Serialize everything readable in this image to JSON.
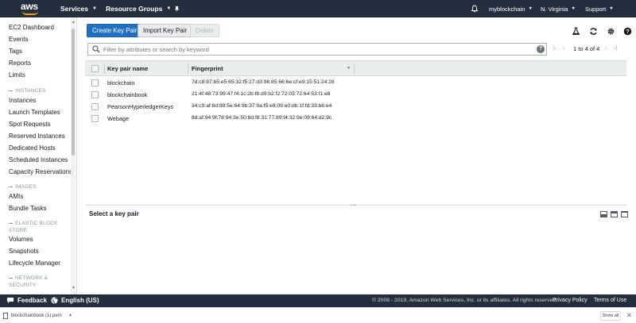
{
  "topnav": {
    "logo": "aws",
    "services": "Services",
    "resource_groups": "Resource Groups",
    "account": "myblockchain",
    "region": "N. Virginia",
    "support": "Support"
  },
  "sidebar": {
    "items_top": [
      "EC2 Dashboard",
      "Events",
      "Tags",
      "Reports",
      "Limits"
    ],
    "section_instances": "INSTANCES",
    "items_instances": [
      "Instances",
      "Launch Templates",
      "Spot Requests",
      "Reserved Instances",
      "Dedicated Hosts",
      "Scheduled Instances",
      "Capacity Reservations"
    ],
    "section_images": "IMAGES",
    "items_images": [
      "AMIs",
      "Bundle Tasks"
    ],
    "section_ebs_1": "ELASTIC BLOCK",
    "section_ebs_2": "STORE",
    "items_ebs": [
      "Volumes",
      "Snapshots",
      "Lifecycle Manager"
    ],
    "section_net_1": "NETWORK &",
    "section_net_2": "SECURITY"
  },
  "toolbar": {
    "create": "Create Key Pair",
    "import": "Import Key Pair",
    "delete": "Delete"
  },
  "search": {
    "placeholder": "Filter by attributes or search by keyword"
  },
  "pager": {
    "text": "1 to 4 of 4"
  },
  "table": {
    "columns": [
      "Key pair name",
      "Fingerprint"
    ],
    "rows": [
      {
        "name": "blockchain",
        "fingerprint": "7d:c8:87:b5:e5:65:32:f5:27:d3:96:85:66:6e:cf:e9:15:51:24:26"
      },
      {
        "name": "blockchainbook",
        "fingerprint": "21:4f:48:73:99:47:f4:1c:2b:f8:d9:b2:f2:72:03:72:64:53:f1:e8"
      },
      {
        "name": "PearsonHyperledgerKeys",
        "fingerprint": "34:c9:af:8d:89:5e:64:9b:37:9a:f5:e8:09:e0:db:1f:fd:33:b6:e4"
      },
      {
        "name": "Webage",
        "fingerprint": "8d:af:94:9f:78:94:3e:50:8d:f8:31:77:89:f4:32:9e:09:64:d2:9c"
      }
    ]
  },
  "detail": {
    "title": "Select a key pair"
  },
  "footer": {
    "feedback": "Feedback",
    "language": "English (US)",
    "copyright": "© 2008 - 2019, Amazon Web Services, Inc. or its affiliates. All rights reserved.",
    "privacy": "Privacy Policy",
    "terms": "Terms of Use"
  },
  "download": {
    "filename": "blockchainbook (1).pem",
    "show_all": "Show all"
  },
  "colors": {
    "nav_bg": "#232f3e",
    "primary": "#1f6fc5",
    "accent": "#ff9900"
  }
}
